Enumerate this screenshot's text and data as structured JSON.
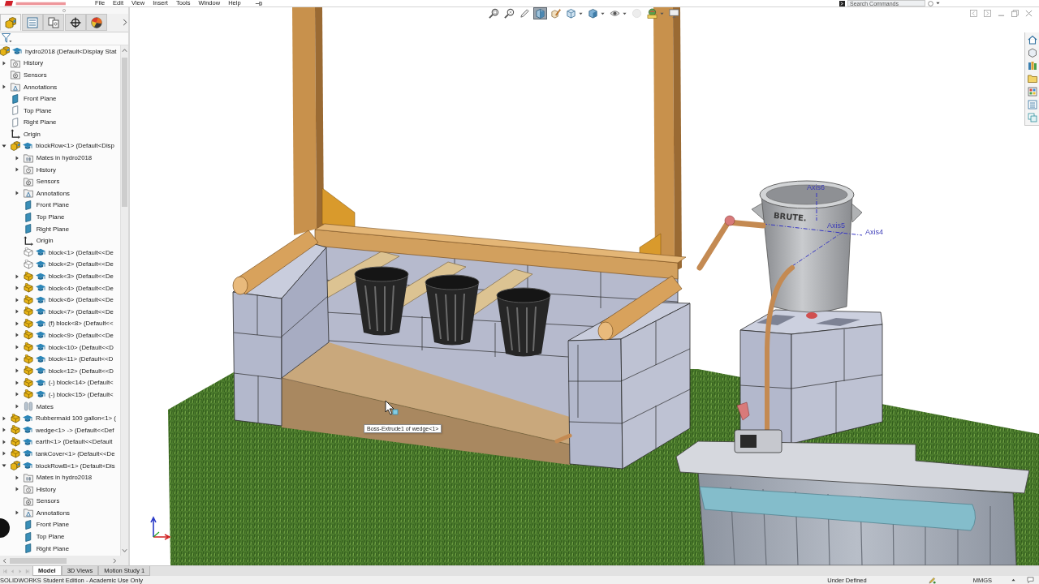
{
  "menu_bar": {
    "items": [
      "File",
      "Edit",
      "View",
      "Insert",
      "Tools",
      "Window",
      "Help"
    ],
    "search": {
      "placeholder": "Search Commands"
    }
  },
  "panel_tabs": [
    {
      "kind": "tree",
      "selected": true
    },
    {
      "kind": "properties",
      "selected": false
    },
    {
      "kind": "config",
      "selected": false
    },
    {
      "kind": "target",
      "selected": false
    },
    {
      "kind": "appearance",
      "selected": false
    }
  ],
  "feature_tree": {
    "root": {
      "kind": "assembly",
      "label": "hydro2018 (Default<Display Stat",
      "hidden": false,
      "children": [
        {
          "kind": "history",
          "label": "History",
          "hidden": false,
          "expanded": false
        },
        {
          "kind": "sensors",
          "label": "Sensors",
          "hidden": false
        },
        {
          "kind": "annotations",
          "label": "Annotations",
          "hidden": false,
          "expanded": false
        },
        {
          "kind": "plane",
          "label": "Front Plane",
          "hidden": false
        },
        {
          "kind": "plane",
          "label": "Top Plane",
          "hidden": true
        },
        {
          "kind": "plane",
          "label": "Right Plane",
          "hidden": true
        },
        {
          "kind": "origin",
          "label": "Origin",
          "hidden": false
        },
        {
          "kind": "assembly",
          "label": "blockRow<1> (Default<Disp",
          "hidden": false,
          "expanded": true,
          "children": [
            {
              "kind": "matefolder",
              "label": "Mates in hydro2018",
              "hidden": false,
              "expanded": false
            },
            {
              "kind": "history",
              "label": "History",
              "hidden": false,
              "expanded": false
            },
            {
              "kind": "sensors",
              "label": "Sensors",
              "hidden": false
            },
            {
              "kind": "annotations",
              "label": "Annotations",
              "hidden": false,
              "expanded": false
            },
            {
              "kind": "plane",
              "label": "Front Plane",
              "hidden": false
            },
            {
              "kind": "plane",
              "label": "Top Plane",
              "hidden": false
            },
            {
              "kind": "plane",
              "label": "Right Plane",
              "hidden": false
            },
            {
              "kind": "origin",
              "label": "Origin",
              "hidden": false
            },
            {
              "kind": "part",
              "label": "block<1> (Default<<De",
              "hidden": true
            },
            {
              "kind": "part",
              "label": "block<2> (Default<<De",
              "hidden": true
            },
            {
              "kind": "part",
              "label": "block<3> (Default<<De",
              "hidden": false,
              "expanded": false
            },
            {
              "kind": "part",
              "label": "block<4> (Default<<De",
              "hidden": false,
              "expanded": false
            },
            {
              "kind": "part",
              "label": "block<6> (Default<<De",
              "hidden": false,
              "expanded": false
            },
            {
              "kind": "part",
              "label": "block<7> (Default<<De",
              "hidden": false,
              "expanded": false
            },
            {
              "kind": "part",
              "label": "(f) block<8> (Default<<",
              "hidden": false,
              "expanded": false
            },
            {
              "kind": "part",
              "label": "block<9> (Default<<De",
              "hidden": false,
              "expanded": false
            },
            {
              "kind": "part",
              "label": "block<10> (Default<<D",
              "hidden": false,
              "expanded": false
            },
            {
              "kind": "part",
              "label": "block<11> (Default<<D",
              "hidden": false,
              "expanded": false
            },
            {
              "kind": "part",
              "label": "block<12> (Default<<D",
              "hidden": false,
              "expanded": false
            },
            {
              "kind": "part",
              "label": "(-) block<14> (Default<",
              "hidden": false,
              "expanded": false
            },
            {
              "kind": "part",
              "label": "(-) block<15> (Default<",
              "hidden": false,
              "expanded": false
            },
            {
              "kind": "mates",
              "label": "Mates",
              "hidden": false,
              "expanded": false
            }
          ]
        },
        {
          "kind": "part",
          "label": "Rubbermaid 100 gallon<1> (",
          "hidden": false,
          "expanded": false
        },
        {
          "kind": "part",
          "label": "wedge<1> -> (Default<<Def",
          "hidden": false,
          "expanded": false
        },
        {
          "kind": "part",
          "label": "earth<1> (Default<<Default",
          "hidden": false,
          "expanded": false
        },
        {
          "kind": "part",
          "label": "tankCover<1> (Default<<De",
          "hidden": false,
          "expanded": false
        },
        {
          "kind": "assembly",
          "label": "blockRowB<1> (Default<Dis",
          "hidden": false,
          "expanded": true,
          "children": [
            {
              "kind": "matefolder",
              "label": "Mates in hydro2018",
              "hidden": false,
              "expanded": false
            },
            {
              "kind": "history",
              "label": "History",
              "hidden": false,
              "expanded": false
            },
            {
              "kind": "sensors",
              "label": "Sensors",
              "hidden": false
            },
            {
              "kind": "annotations",
              "label": "Annotations",
              "hidden": false,
              "expanded": false
            },
            {
              "kind": "plane",
              "label": "Front Plane",
              "hidden": false
            },
            {
              "kind": "plane",
              "label": "Top Plane",
              "hidden": false
            },
            {
              "kind": "plane",
              "label": "Right Plane",
              "hidden": false
            }
          ]
        }
      ]
    }
  },
  "viewport": {
    "view_toolbar": [
      {
        "kind": "zoomfit",
        "selected": false,
        "disabled": false,
        "dropdown": false
      },
      {
        "kind": "zoomarea",
        "selected": false,
        "disabled": false,
        "dropdown": false
      },
      {
        "kind": "previous",
        "selected": false,
        "disabled": false,
        "dropdown": false
      },
      {
        "kind": "section",
        "selected": true,
        "disabled": false,
        "dropdown": false
      },
      {
        "kind": "annotation",
        "selected": false,
        "disabled": false,
        "dropdown": false
      },
      {
        "kind": "orientation",
        "selected": false,
        "disabled": false,
        "dropdown": true
      },
      {
        "kind": "display",
        "selected": false,
        "disabled": false,
        "dropdown": true
      },
      {
        "kind": "hideshow",
        "selected": false,
        "disabled": false,
        "dropdown": true
      },
      {
        "kind": "appearance",
        "selected": false,
        "disabled": true,
        "dropdown": false
      },
      {
        "kind": "scene",
        "selected": false,
        "disabled": false,
        "dropdown": true
      },
      {
        "kind": "settings",
        "selected": false,
        "disabled": false,
        "dropdown": false
      }
    ],
    "axes": [
      {
        "label": "Axis6"
      },
      {
        "label": "Axis5"
      },
      {
        "label": "Axis4"
      }
    ],
    "bucket_label": "BRUTE.",
    "tooltip": "Boss-Extrude1 of wedge<1>"
  },
  "bottom_tabs": [
    {
      "label": "Model",
      "selected": true
    },
    {
      "label": "3D Views",
      "selected": false
    },
    {
      "label": "Motion Study 1",
      "selected": false
    }
  ],
  "status_bar": {
    "edition": "SOLIDWORKS Student Edition - Academic Use Only",
    "state": "Under Defined",
    "units": "MMGS"
  }
}
